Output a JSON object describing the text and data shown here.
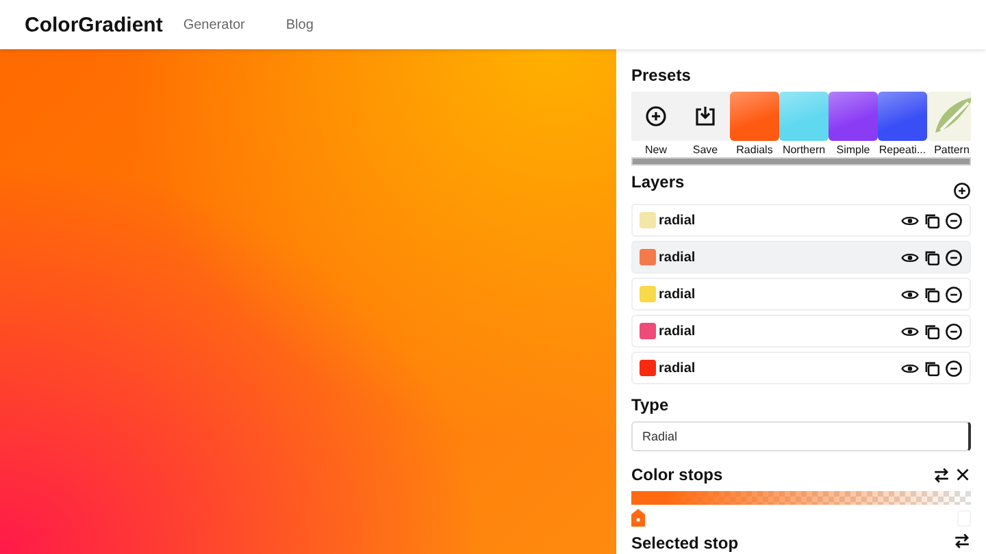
{
  "header": {
    "logo": "ColorGradient",
    "nav": [
      "Generator",
      "Blog"
    ]
  },
  "presets": {
    "title": "Presets",
    "items": [
      {
        "kind": "new",
        "label": "New"
      },
      {
        "kind": "save",
        "label": "Save"
      },
      {
        "kind": "swatch",
        "label": "Radials",
        "color": "#ff5a12"
      },
      {
        "kind": "swatch",
        "label": "Northern",
        "color": "#5fd8f0"
      },
      {
        "kind": "swatch",
        "label": "Simple",
        "color": "#8a3cf5"
      },
      {
        "kind": "swatch",
        "label": "Repeati...",
        "color": "#3a4ef5"
      },
      {
        "kind": "pattern",
        "label": "Pattern"
      }
    ]
  },
  "layers": {
    "title": "Layers",
    "items": [
      {
        "name": "radial",
        "color": "#f3e6a6",
        "selected": false
      },
      {
        "name": "radial",
        "color": "#f57a4a",
        "selected": true
      },
      {
        "name": "radial",
        "color": "#f7d94a",
        "selected": false
      },
      {
        "name": "radial",
        "color": "#ee4a7a",
        "selected": false
      },
      {
        "name": "radial",
        "color": "#f82a10",
        "selected": false
      }
    ]
  },
  "type": {
    "label": "Type",
    "value": "Radial"
  },
  "color_stops": {
    "title": "Color stops",
    "color": "#ff6a10"
  },
  "selected_stop": {
    "title": "Selected stop"
  }
}
